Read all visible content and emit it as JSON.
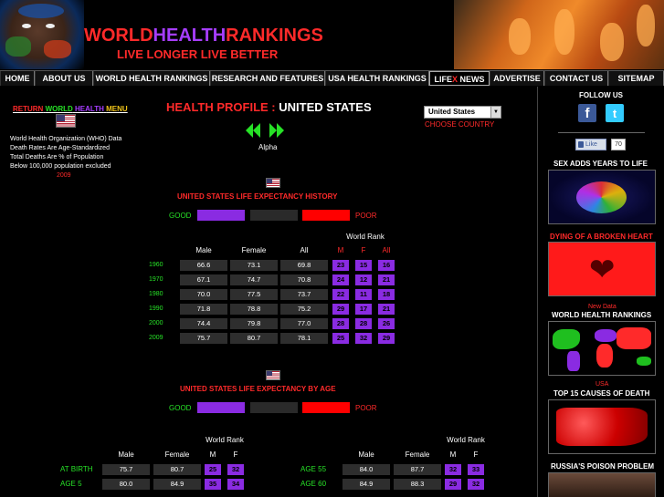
{
  "site": {
    "logo_world": "WORLD",
    "logo_health": "HEALTH",
    "logo_rankings": "RANKINGS",
    "tagline": "LIVE LONGER LIVE BETTER"
  },
  "nav": [
    {
      "label": "HOME"
    },
    {
      "label": "ABOUT US"
    },
    {
      "label": "WORLD HEALTH RANKINGS"
    },
    {
      "label": "RESEARCH AND FEATURES"
    },
    {
      "label": "USA HEALTH RANKINGS"
    },
    {
      "pre": "LIFE",
      "x": "X",
      "post": " NEWS"
    },
    {
      "label": "ADVERTISE"
    },
    {
      "label": "CONTACT US"
    },
    {
      "label": "SITEMAP"
    }
  ],
  "left": {
    "return_return": "RETURN",
    "return_world": "WORLD",
    "return_health": "HEALTH",
    "return_menu": "MENU",
    "info_lines": [
      "World Health Organization (WHO) Data",
      "Death Rates Are Age-Standardized",
      "Total Deaths Are % of Population",
      "Below 100,000 population excluded"
    ],
    "year": "2009"
  },
  "profile": {
    "title_label": "HEALTH PROFILE :",
    "title_country": "UNITED STATES",
    "alpha": "Alpha",
    "select_value": "United States",
    "choose": "CHOOSE COUNTRY"
  },
  "history": {
    "title": "UNITED STATES LIFE EXPECTANCY HISTORY",
    "good": "GOOD",
    "poor": "POOR",
    "world_rank": "World Rank",
    "headers": [
      "Male",
      "Female",
      "All"
    ],
    "rank_headers": [
      "M",
      "F",
      "All"
    ],
    "rows": [
      {
        "year": "1960",
        "male": "66.6",
        "female": "73.1",
        "all": "69.8",
        "rm": "23",
        "rf": "15",
        "ra": "16"
      },
      {
        "year": "1970",
        "male": "67.1",
        "female": "74.7",
        "all": "70.8",
        "rm": "24",
        "rf": "12",
        "ra": "21"
      },
      {
        "year": "1980",
        "male": "70.0",
        "female": "77.5",
        "all": "73.7",
        "rm": "22",
        "rf": "11",
        "ra": "18"
      },
      {
        "year": "1990",
        "male": "71.8",
        "female": "78.8",
        "all": "75.2",
        "rm": "29",
        "rf": "17",
        "ra": "21"
      },
      {
        "year": "2000",
        "male": "74.4",
        "female": "79.8",
        "all": "77.0",
        "rm": "28",
        "rf": "28",
        "ra": "26"
      },
      {
        "year": "2009",
        "male": "75.7",
        "female": "80.7",
        "all": "78.1",
        "rm": "25",
        "rf": "32",
        "ra": "29"
      }
    ]
  },
  "by_age": {
    "title": "UNITED STATES LIFE EXPECTANCY BY AGE",
    "good": "GOOD",
    "poor": "POOR",
    "world_rank": "World Rank",
    "headers": [
      "Male",
      "Female"
    ],
    "rank_headers": [
      "M",
      "F"
    ],
    "left_rows": [
      {
        "label": "AT BIRTH",
        "male": "75.7",
        "female": "80.7",
        "rm": "25",
        "rf": "32"
      },
      {
        "label": "AGE 5",
        "male": "80.0",
        "female": "84.9",
        "rm": "35",
        "rf": "34"
      }
    ],
    "right_rows": [
      {
        "label": "AGE 55",
        "male": "84.0",
        "female": "87.7",
        "rm": "32",
        "rf": "33"
      },
      {
        "label": "AGE 60",
        "male": "84.9",
        "female": "88.3",
        "rm": "29",
        "rf": "32"
      }
    ]
  },
  "sidebar": {
    "follow_us": "FOLLOW US",
    "like": "Like",
    "like_count": "70",
    "sex_title": "SEX ADDS YEARS TO LIFE",
    "broken_heart": "DYING OF A BROKEN HEART",
    "new_data": "New Data",
    "whr_title": "WORLD HEALTH RANKINGS",
    "usa": "USA",
    "causes_title": "TOP 15 CAUSES OF DEATH",
    "poison_title": "RUSSIA'S POISON PROBLEM"
  },
  "colors": {
    "accent_red": "#ff2a2a",
    "accent_green": "#27e227",
    "accent_purple": "#8a2be2"
  }
}
